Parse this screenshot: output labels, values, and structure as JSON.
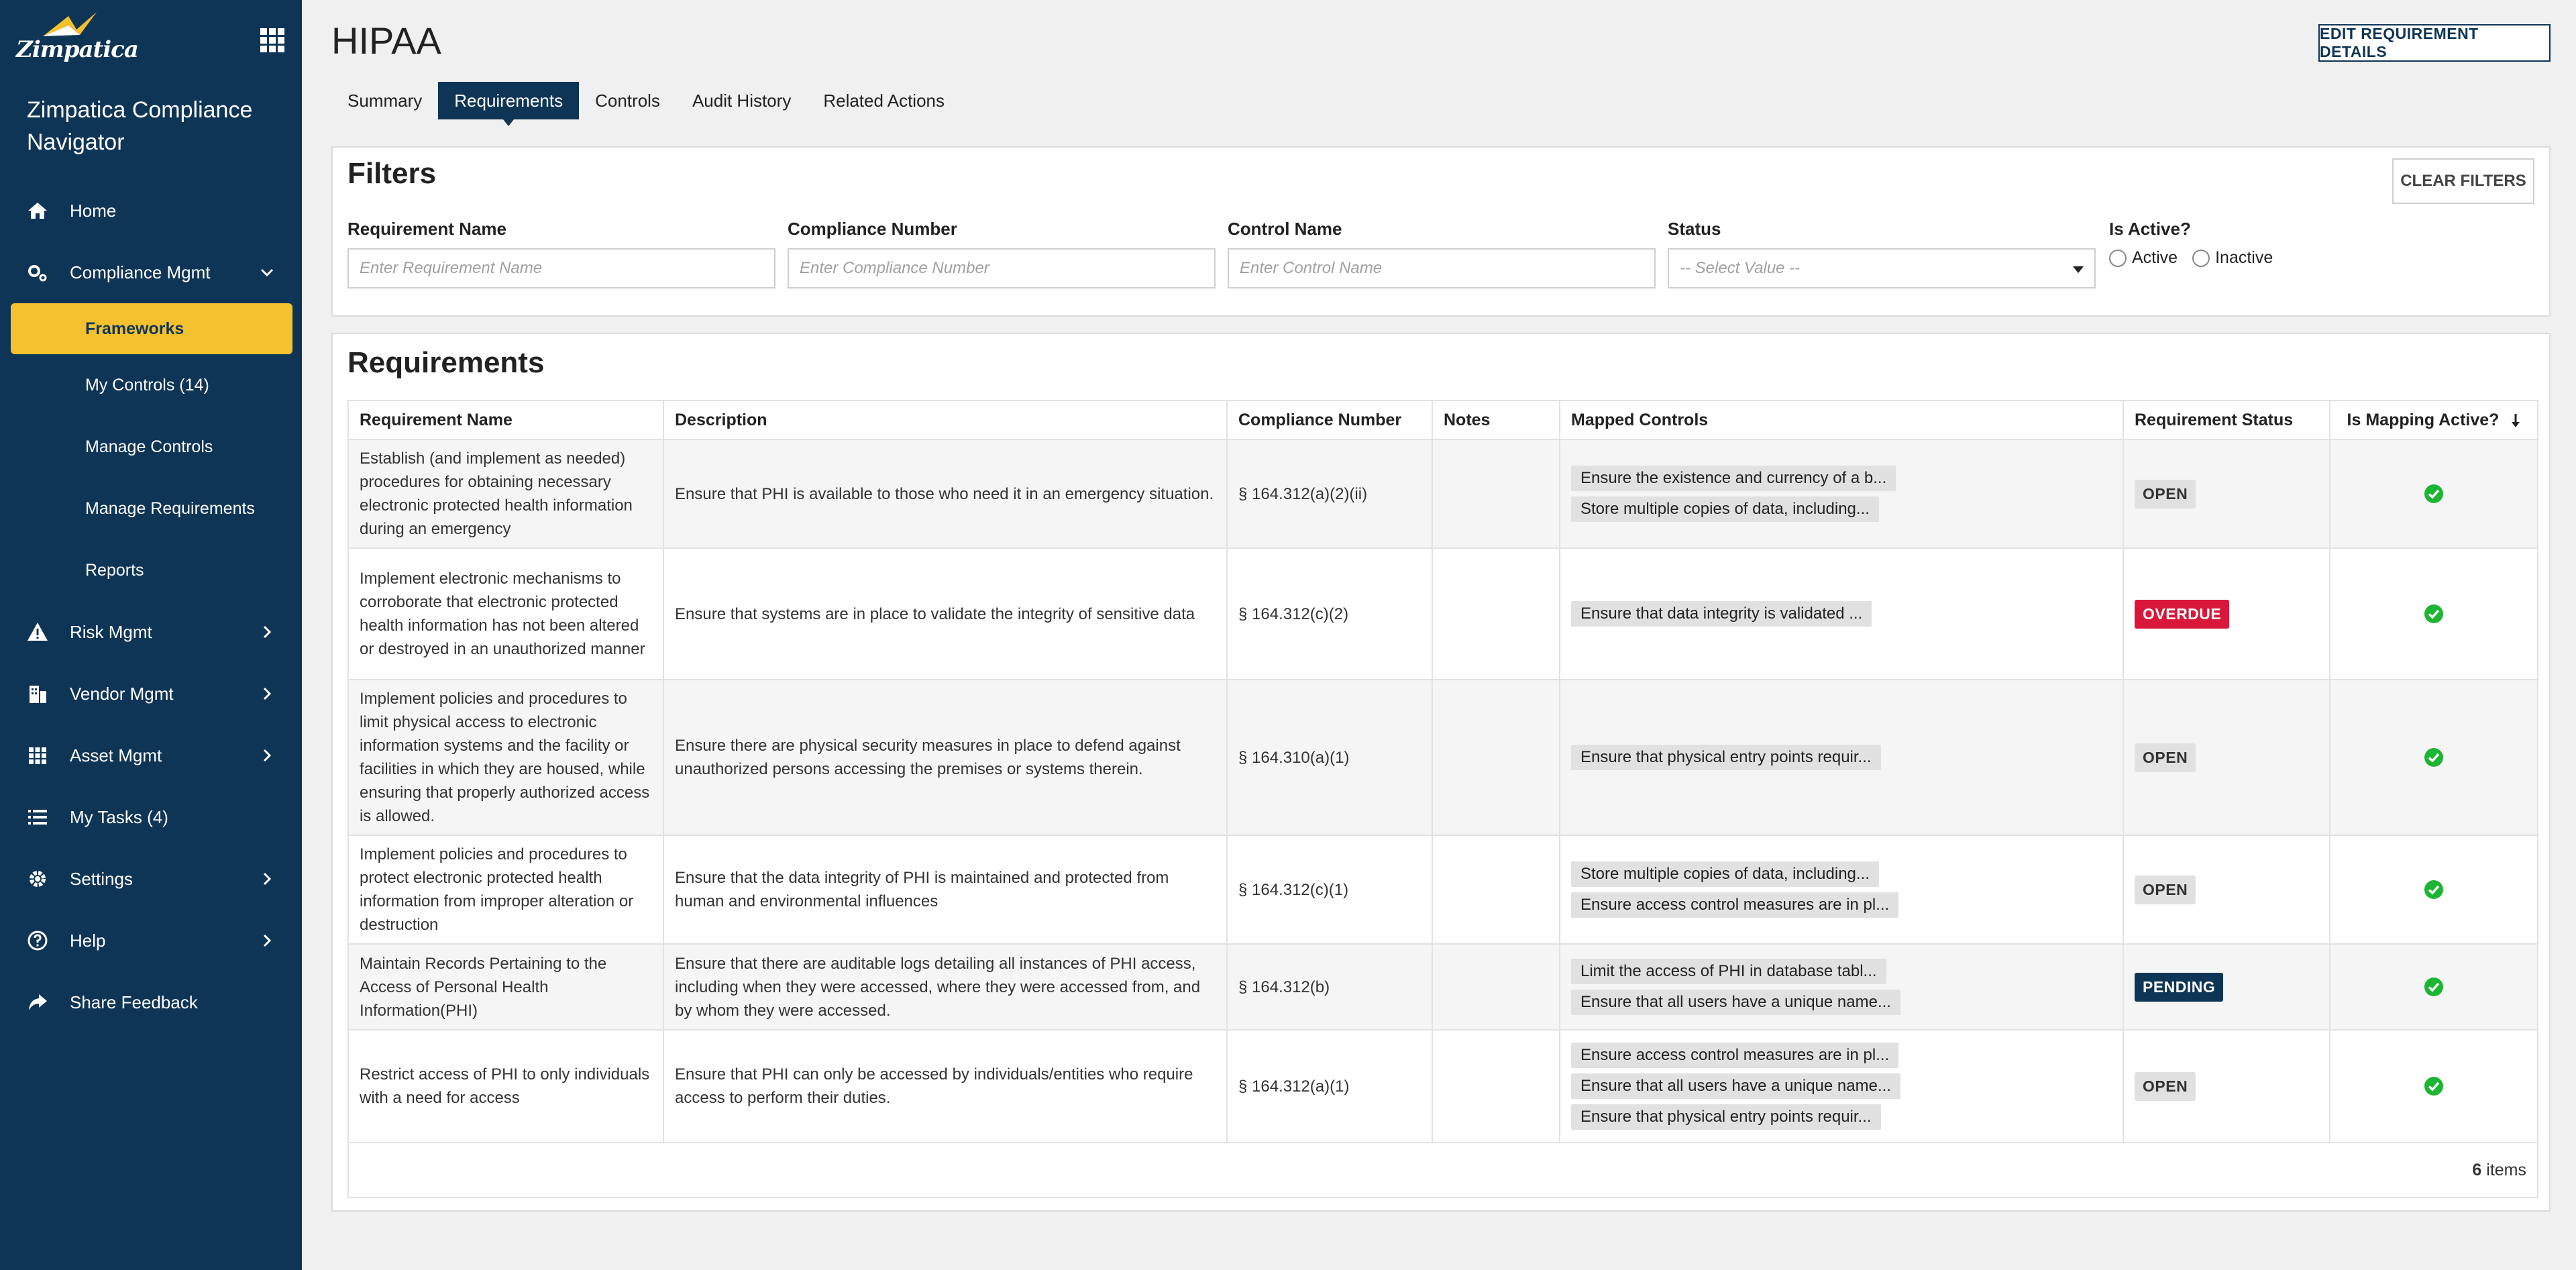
{
  "sidebar": {
    "logo_text": "Zimpatica",
    "app_name": "Zimpatica Compliance Navigator",
    "items": [
      {
        "label": "Home",
        "icon": "home-icon"
      },
      {
        "label": "Compliance Mgmt",
        "icon": "gears-icon",
        "expanded": true
      },
      {
        "label": "Frameworks",
        "sub": true,
        "active": true
      },
      {
        "label": "My Controls (14)",
        "sub": true
      },
      {
        "label": "Manage Controls",
        "sub": true
      },
      {
        "label": "Manage Requirements",
        "sub": true
      },
      {
        "label": "Reports",
        "sub": true
      },
      {
        "label": "Risk Mgmt",
        "icon": "warning-icon"
      },
      {
        "label": "Vendor Mgmt",
        "icon": "building-icon"
      },
      {
        "label": "Asset Mgmt",
        "icon": "grid-icon"
      },
      {
        "label": "My Tasks (4)",
        "icon": "list-icon"
      },
      {
        "label": "Settings",
        "icon": "gear-icon"
      },
      {
        "label": "Help",
        "icon": "help-icon"
      },
      {
        "label": "Share Feedback",
        "icon": "share-icon"
      }
    ]
  },
  "header": {
    "title": "HIPAA",
    "edit_button": "EDIT REQUIREMENT DETAILS",
    "tabs": [
      "Summary",
      "Requirements",
      "Controls",
      "Audit History",
      "Related Actions"
    ],
    "active_tab": "Requirements"
  },
  "filters": {
    "title": "Filters",
    "clear_button": "CLEAR FILTERS",
    "requirement_name": {
      "label": "Requirement Name",
      "placeholder": "Enter Requirement Name",
      "value": ""
    },
    "compliance_number": {
      "label": "Compliance Number",
      "placeholder": "Enter Compliance Number",
      "value": ""
    },
    "control_name": {
      "label": "Control Name",
      "placeholder": "Enter Control Name",
      "value": ""
    },
    "status": {
      "label": "Status",
      "placeholder": "-- Select Value --"
    },
    "is_active": {
      "label": "Is Active?",
      "options": [
        "Active",
        "Inactive"
      ]
    }
  },
  "requirements": {
    "title": "Requirements",
    "columns": [
      "Requirement Name",
      "Description",
      "Compliance Number",
      "Notes",
      "Mapped Controls",
      "Requirement Status",
      "Is Mapping Active?"
    ],
    "rows": [
      {
        "name": "Establish (and implement as needed) procedures for obtaining necessary electronic protected health information during an emergency",
        "description": "Ensure that PHI is available to those who need it in an emergency situation.",
        "compliance_number": "§ 164.312(a)(2)(ii)",
        "notes": "",
        "controls": [
          "Ensure the existence and currency of a b...",
          "Store multiple copies of data, including..."
        ],
        "status": "OPEN",
        "status_color": "#e1e1e1"
      },
      {
        "name": "Implement electronic mechanisms to corroborate that electronic protected health information has not been altered or destroyed in an unauthorized manner",
        "description": "Ensure that systems are in place to validate the integrity of sensitive data",
        "compliance_number": "§ 164.312(c)(2)",
        "notes": "",
        "controls": [
          "Ensure that data integrity is validated ..."
        ],
        "status": "OVERDUE",
        "status_color": "#d8173a"
      },
      {
        "name": "Implement policies and procedures to limit physical access to electronic information systems and the facility or facilities in which they are housed, while ensuring that properly authorized access is allowed.",
        "description": "Ensure there are physical security measures in place to defend against unauthorized persons accessing the premises or systems therein.",
        "compliance_number": "§ 164.310(a)(1)",
        "notes": "",
        "controls": [
          "Ensure that physical entry points requir..."
        ],
        "status": "OPEN",
        "status_color": "#e1e1e1"
      },
      {
        "name": "Implement policies and procedures to protect electronic protected health information from improper alteration or destruction",
        "description": "Ensure that the data integrity of PHI is maintained and protected from human and environmental influences",
        "compliance_number": "§ 164.312(c)(1)",
        "notes": "",
        "controls": [
          "Store multiple copies of data, including...",
          "Ensure access control measures are in pl..."
        ],
        "status": "OPEN",
        "status_color": "#e1e1e1"
      },
      {
        "name": "Maintain Records Pertaining to the Access of Personal Health Information(PHI)",
        "description": "Ensure that there are auditable logs detailing all instances of PHI access, including when they were accessed, where they were accessed from, and by whom they were accessed.",
        "compliance_number": "§ 164.312(b)",
        "notes": "",
        "controls": [
          "Limit the access of PHI in database tabl...",
          "Ensure that all users have a unique name..."
        ],
        "status": "PENDING",
        "status_color": "#0f3556"
      },
      {
        "name": "Restrict access of PHI to only individuals with a need for access",
        "description": "Ensure that PHI can only be accessed by individuals/entities who require access to perform their duties.",
        "compliance_number": "§ 164.312(a)(1)",
        "notes": "",
        "controls": [
          "Ensure access control measures are in pl...",
          "Ensure that all users have a unique name...",
          "Ensure that physical entry points requir..."
        ],
        "status": "OPEN",
        "status_color": "#e1e1e1"
      }
    ],
    "item_count": "6",
    "item_count_suffix": " items"
  },
  "colors": {
    "sidebar": "#0f3556",
    "accent": "#f5c12e",
    "check": "#1db534"
  }
}
